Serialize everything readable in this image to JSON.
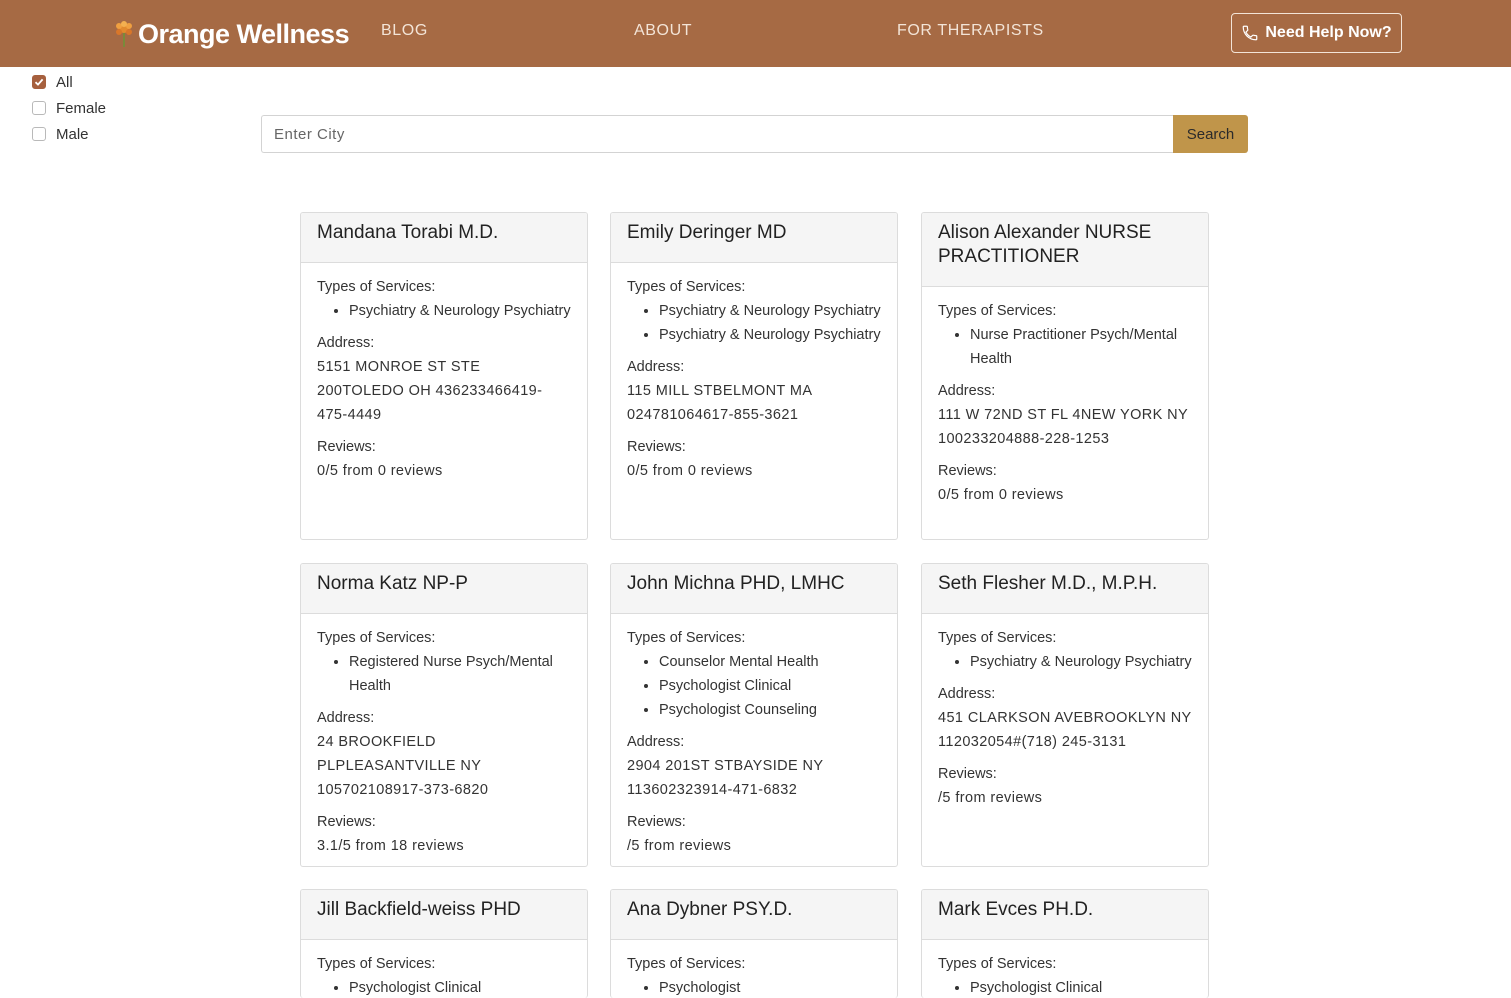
{
  "header": {
    "brand": "Orange Wellness",
    "nav": [
      "BLOG",
      "ABOUT",
      "FOR THERAPISTS"
    ],
    "help_button": "Need Help Now?"
  },
  "filters": [
    {
      "label": "All",
      "checked": true
    },
    {
      "label": "Female",
      "checked": false
    },
    {
      "label": "Male",
      "checked": false
    }
  ],
  "search": {
    "placeholder": "Enter City",
    "button": "Search"
  },
  "labels": {
    "services": "Types of Services:",
    "address": "Address:",
    "reviews": "Reviews:"
  },
  "providers": [
    {
      "name": "Mandana Torabi M.D.",
      "services": [
        "Psychiatry & Neurology Psychiatry"
      ],
      "address": "5151 MONROE ST STE 200TOLEDO OH 436233466419-475-4449",
      "reviews": "0/5 from 0 reviews"
    },
    {
      "name": "Emily Deringer MD",
      "services": [
        "Psychiatry & Neurology Psychiatry",
        "Psychiatry & Neurology Psychiatry"
      ],
      "address": "115 MILL STBELMONT MA 024781064617-855-3621",
      "reviews": "0/5 from 0 reviews"
    },
    {
      "name": "Alison Alexander NURSE PRACTITIONER",
      "services": [
        "Nurse Practitioner Psych/Mental Health"
      ],
      "address": "111 W 72ND ST FL 4NEW YORK NY 100233204888-228-1253",
      "reviews": "0/5 from 0 reviews"
    },
    {
      "name": "Norma Katz NP-P",
      "services": [
        "Registered Nurse Psych/Mental Health"
      ],
      "address": "24 BROOKFIELD PLPLEASANTVILLE NY 105702108917-373-6820",
      "reviews": "3.1/5 from 18 reviews"
    },
    {
      "name": "John Michna PHD, LMHC",
      "services": [
        "Counselor Mental Health",
        "Psychologist Clinical",
        "Psychologist Counseling"
      ],
      "address": "2904 201ST STBAYSIDE NY 113602323914-471-6832",
      "reviews": "/5 from reviews"
    },
    {
      "name": "Seth Flesher M.D., M.P.H.",
      "services": [
        "Psychiatry & Neurology Psychiatry"
      ],
      "address": "451 CLARKSON AVEBROOKLYN NY 112032054#(718) 245-3131",
      "reviews": "/5 from reviews"
    },
    {
      "name": "Jill Backfield-weiss PHD",
      "services": [
        "Psychologist Clinical"
      ],
      "address": "",
      "reviews": ""
    },
    {
      "name": "Ana Dybner PSY.D.",
      "services": [
        "Psychologist"
      ],
      "address": "",
      "reviews": ""
    },
    {
      "name": "Mark Evces PH.D.",
      "services": [
        "Psychologist Clinical"
      ],
      "address": "",
      "reviews": ""
    }
  ],
  "colors": {
    "header_bg": "#a66a44",
    "accent": "#c0954a",
    "checkbox": "#a6603e"
  },
  "icons": {
    "logo": "flower-icon",
    "help": "phone-icon",
    "check": "check-icon"
  }
}
